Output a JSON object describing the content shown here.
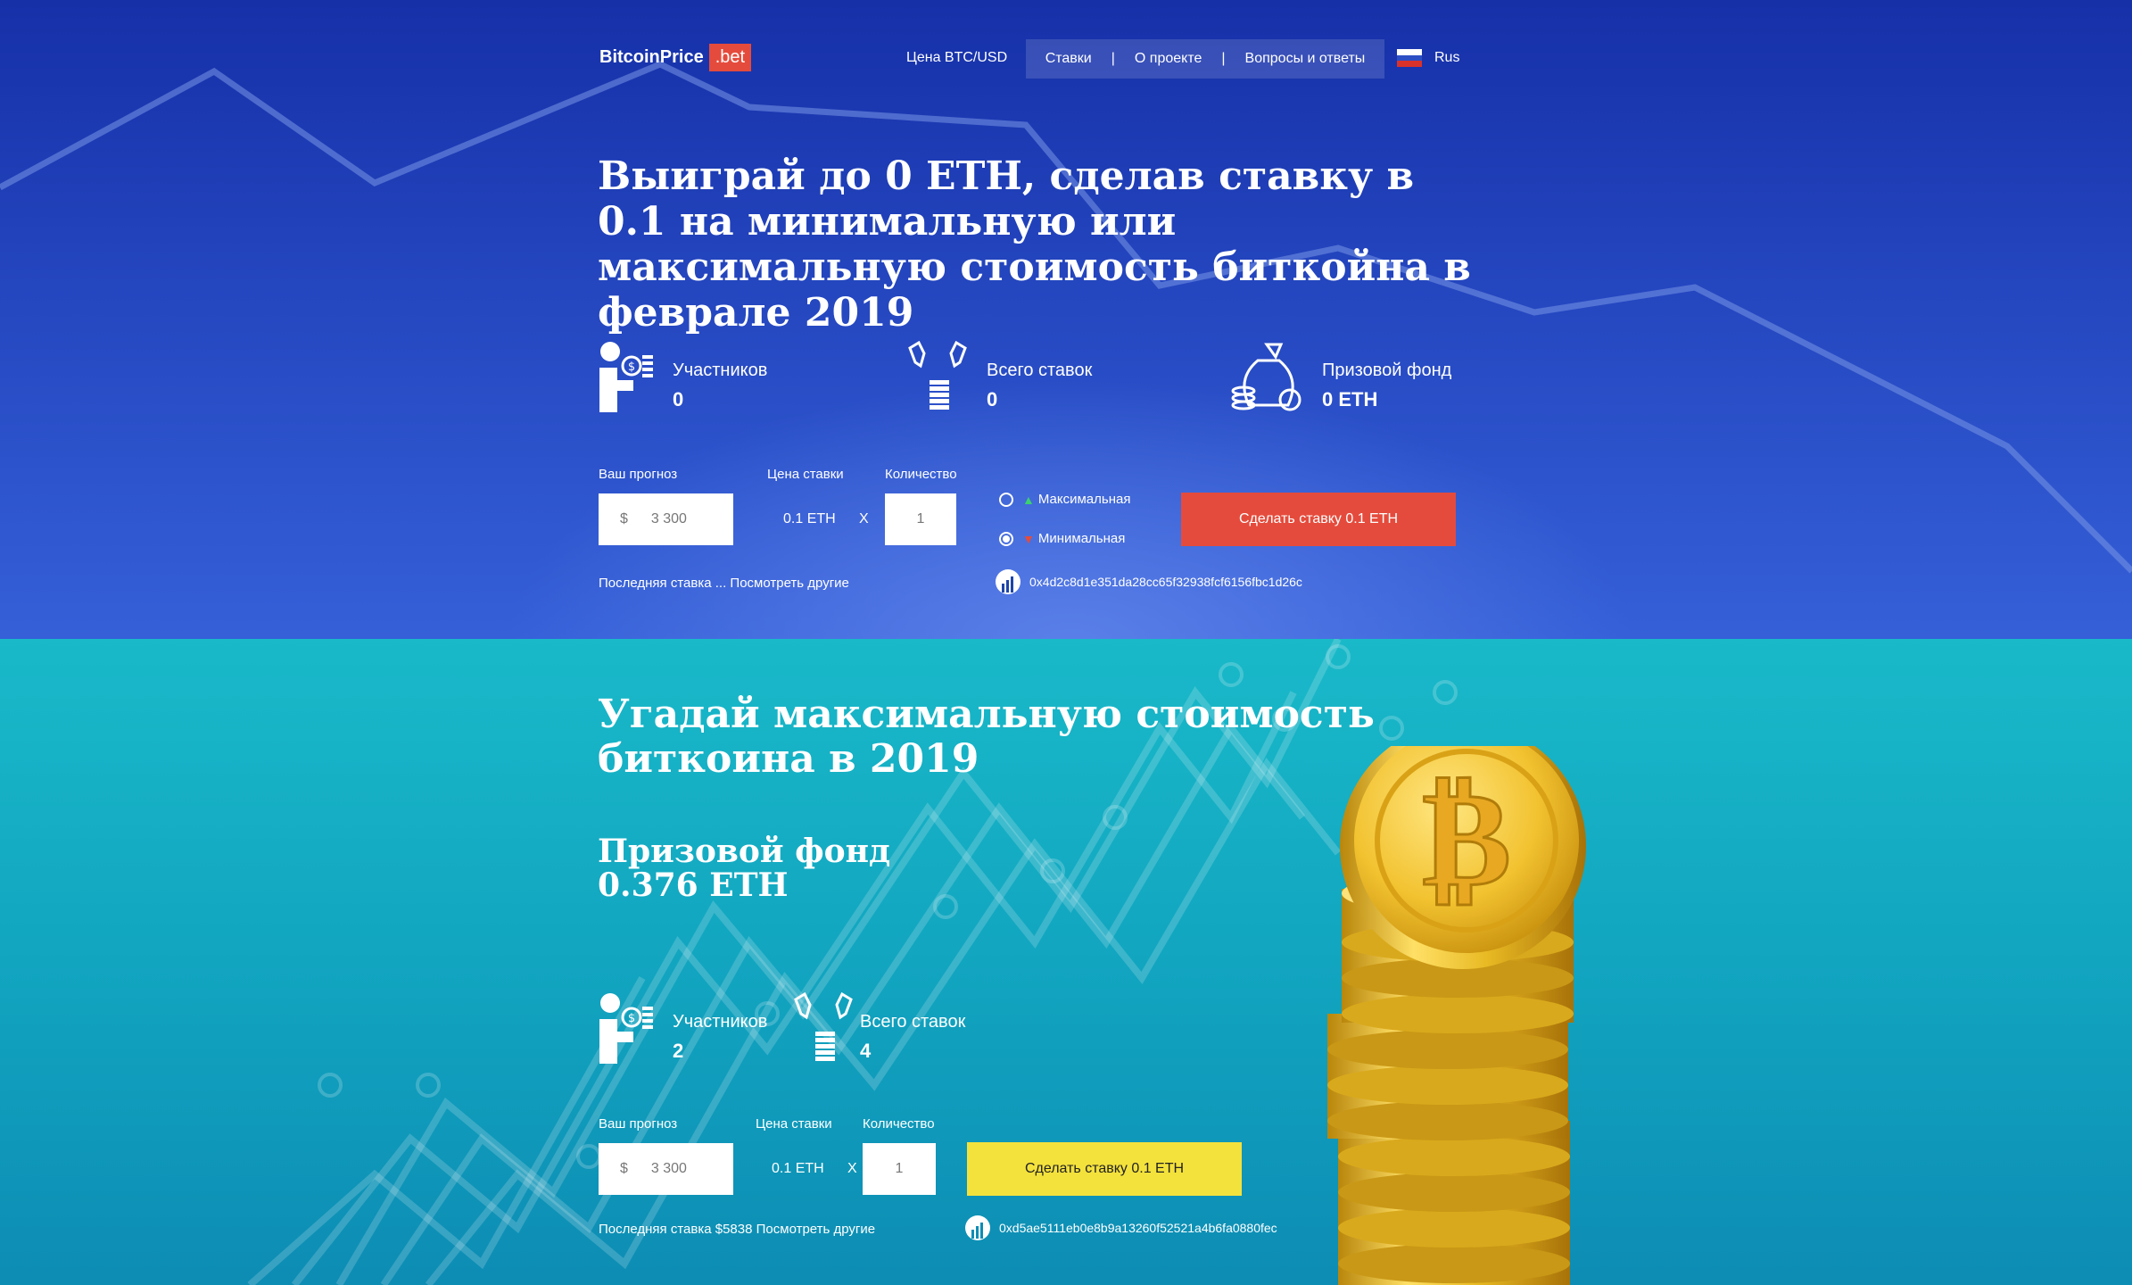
{
  "header": {
    "logo_text": "BitcoinPrice",
    "logo_suffix": ".bet",
    "nav_price": "Цена BTC/USD",
    "nav_items": [
      "Ставки",
      "О проекте",
      "Вопросы и ответы"
    ],
    "nav_separator": "|",
    "language": "Rus"
  },
  "hero": {
    "title": "Выиграй до 0 ETH, сделав ставку в 0.1 на минимальную или максимальную стоимость биткойна в феврале 2019",
    "stats": {
      "participants_label": "Участников",
      "participants_value": "0",
      "bets_label": "Всего ставок",
      "bets_value": "0",
      "fund_label": "Призовой фонд",
      "fund_value": "0 ETH"
    },
    "form": {
      "forecast_label": "Ваш прогноз",
      "price_label": "Цена ставки",
      "qty_label": "Количество",
      "currency": "$",
      "forecast_value": "3 300",
      "price_value": "0.1 ETH",
      "multiply": "X",
      "qty_value": "1",
      "option_max": "Максимальная",
      "option_min": "Минимальная",
      "selected_option": "min",
      "submit": "Сделать ставку 0.1 ETH"
    },
    "last_bet": "Последняя ставка ... Посмотреть другие",
    "contract": "0x4d2c8d1e351da28cc65f32938fcf6156fbc1d26c"
  },
  "yearly": {
    "title": "Угадай максимальную стоимость биткоина в 2019",
    "fund_title": "Призовой фонд",
    "fund_value": "0.376 ETH",
    "stats": {
      "participants_label": "Участников",
      "participants_value": "2",
      "bets_label": "Всего ставок",
      "bets_value": "4"
    },
    "form": {
      "forecast_label": "Ваш прогноз",
      "price_label": "Цена ставки",
      "qty_label": "Количество",
      "currency": "$",
      "forecast_value": "3 300",
      "price_value": "0.1 ETH",
      "multiply": "X",
      "qty_value": "1",
      "submit": "Сделать ставку 0.1 ETH"
    },
    "last_bet": "Последняя ставка $5838 Посмотреть другие",
    "contract": "0xd5ae5111eb0e8b9a13260f52521a4b6fa0880fec"
  },
  "colors": {
    "brand_red": "#e54b3c",
    "accent_yellow": "#f4e23c",
    "up_green": "#3bd16f",
    "down_red": "#e54b3c"
  }
}
